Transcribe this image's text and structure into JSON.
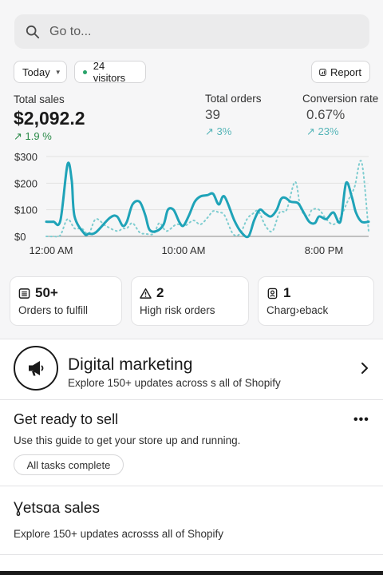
{
  "search": {
    "placeholder": "Go to..."
  },
  "filters": {
    "date_label": "Today",
    "visitors_label": "24 visitors",
    "report_label": "Report"
  },
  "metrics": {
    "total_sales": {
      "label": "Total sales",
      "value": "$2,092.2",
      "delta": "↗ 1.9 %"
    },
    "total_orders": {
      "label": "Total orders",
      "value": "39",
      "delta": "↗ 3%"
    },
    "conversion_rate": {
      "label": "Conversion rate",
      "value": "0.67%",
      "delta": "↗ 23%"
    }
  },
  "colors": {
    "primary_line": "#1fa3b8",
    "comparison_line": "#7fcdd0",
    "positive": "#2a8a48"
  },
  "chart_data": {
    "type": "line",
    "ylim": [
      0,
      300
    ],
    "y_ticks": [
      "$0",
      "$100",
      "$200",
      "$300"
    ],
    "x_ticks": [
      "12:00 AM",
      "10:00 AM",
      "8:00 PM"
    ],
    "grid": true,
    "series": [
      {
        "style": "solid",
        "x": [
          0,
          0.5,
          1.0,
          1.5,
          1.8,
          2.0,
          2.7,
          3.0,
          3.5,
          4.5,
          5.0,
          5.4,
          5.7,
          6.1,
          6.6,
          7.0,
          7.3,
          7.8,
          8.3,
          8.6,
          9.0,
          9.4,
          9.7,
          10.1,
          10.5,
          10.9,
          11.4,
          11.8,
          12.2,
          12.6,
          13.3,
          13.8,
          14.3,
          14.7,
          15.1,
          15.5,
          15.9,
          16.3,
          16.6,
          16.9,
          17.3,
          17.8,
          18.2,
          18.6,
          19.0,
          19.3,
          19.8,
          20.3,
          20.8,
          21.2,
          21.6,
          21.9,
          22.3,
          22.8
        ],
        "values": [
          55,
          55,
          60,
          270,
          210,
          75,
          10,
          10,
          15,
          70,
          75,
          40,
          55,
          120,
          130,
          80,
          25,
          20,
          45,
          100,
          100,
          55,
          40,
          80,
          130,
          150,
          155,
          160,
          120,
          150,
          60,
          15,
          0,
          60,
          100,
          85,
          75,
          100,
          140,
          145,
          130,
          125,
          90,
          55,
          50,
          75,
          65,
          90,
          55,
          200,
          150,
          90,
          55,
          55
        ]
      },
      {
        "style": "dotted",
        "x": [
          0,
          0.5,
          1.0,
          1.5,
          2.0,
          2.5,
          3.0,
          3.5,
          4.2,
          5.0,
          5.4,
          5.7,
          6.1,
          6.6,
          7.0,
          7.6,
          8.0,
          8.5,
          9.2,
          9.8,
          10.4,
          10.9,
          11.4,
          11.8,
          12.2,
          12.6,
          13.2,
          13.7,
          14.2,
          14.6,
          15.0,
          15.5,
          16.0,
          16.5,
          17.0,
          17.6,
          18.0,
          18.5,
          18.8,
          19.3,
          19.8,
          20.3,
          20.8,
          21.3,
          21.8,
          22.3,
          22.8
        ],
        "values": [
          0,
          0,
          5,
          65,
          30,
          30,
          10,
          65,
          40,
          20,
          30,
          30,
          50,
          15,
          10,
          10,
          50,
          20,
          45,
          40,
          60,
          45,
          70,
          95,
          90,
          80,
          10,
          10,
          65,
          85,
          95,
          40,
          20,
          90,
          100,
          205,
          105,
          75,
          100,
          100,
          65,
          45,
          70,
          130,
          185,
          280,
          20
        ]
      }
    ]
  },
  "tasks": [
    {
      "icon": "list-icon",
      "count": "50+",
      "label": "Orders to fulfill"
    },
    {
      "icon": "warning-icon",
      "count": "2",
      "label": "High risk orders"
    },
    {
      "icon": "chargeback-icon",
      "count": "1",
      "label": "Charg›eback"
    }
  ],
  "digital_marketing": {
    "title": "Digital marketing",
    "subtitle": "Explore 150+ updates across s all of Shopify"
  },
  "get_ready": {
    "title": "Get ready to sell",
    "subtitle": "Use this guide to get your store up and running.",
    "status": "All tasks complete",
    "more_label": "•••"
  },
  "retail_sales": {
    "title": "Ɣetsɑa sales",
    "subtitle": "Explore 150+ updates acrosss all of Shopify"
  }
}
